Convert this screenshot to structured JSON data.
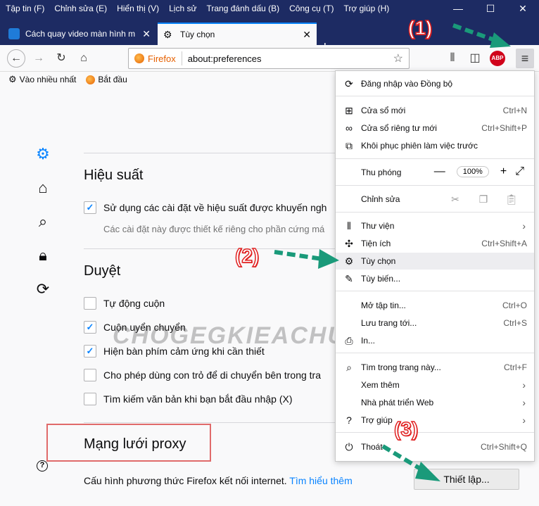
{
  "menubar": [
    "Tập tin (F)",
    "Chỉnh sửa (E)",
    "Hiển thị (V)",
    "Lịch sử",
    "Trang đánh dấu (B)",
    "Công cụ (T)",
    "Trợ giúp (H)"
  ],
  "tabs": [
    {
      "title": "Cách quay video màn hình m",
      "active": false
    },
    {
      "title": "Tùy chọn",
      "active": true
    }
  ],
  "urlbar": {
    "identity": "Firefox",
    "url": "about:preferences"
  },
  "bookmarks": [
    {
      "label": "Vào nhiều nhất",
      "icon": "gear-icon"
    },
    {
      "label": "Bắt đầu",
      "icon": "firefox-icon"
    }
  ],
  "prefs": {
    "performance": {
      "title": "Hiệu suất",
      "recommended_label": "Sử dụng các cài đặt về hiệu suất được khuyến ngh",
      "recommended_checked": true,
      "recommended_hint": "Các cài đặt này được thiết kế riêng cho phần cứng má"
    },
    "browsing": {
      "title": "Duyệt",
      "options": [
        {
          "label": "Tự động cuộn",
          "checked": false
        },
        {
          "label": "Cuộn uyển chuyển",
          "checked": true
        },
        {
          "label": "Hiện bàn phím cảm ứng khi cần thiết",
          "checked": true
        },
        {
          "label": "Cho phép dùng con trỏ để di chuyển bên trong tra",
          "checked": false
        },
        {
          "label": "Tìm kiếm văn bản khi bạn bắt đầu nhập (X)",
          "checked": false
        }
      ]
    },
    "proxy": {
      "title": "Mạng lưới proxy",
      "description": "Cấu hình phương thức Firefox kết nối internet.",
      "learn_more": "Tìm hiểu thêm",
      "settings_button": "Thiết lập..."
    }
  },
  "menu_panel": {
    "sync": "Đăng nhập vào Đồng bộ",
    "new_window": {
      "label": "Cửa sổ mới",
      "shortcut": "Ctrl+N"
    },
    "private_window": {
      "label": "Cửa sổ riêng tư mới",
      "shortcut": "Ctrl+Shift+P"
    },
    "restore_session": "Khôi phục phiên làm việc trước",
    "zoom": {
      "label": "Thu phóng",
      "value": "100%"
    },
    "edit": "Chỉnh sửa",
    "library": "Thư viện",
    "addons": {
      "label": "Tiện ích",
      "shortcut": "Ctrl+Shift+A"
    },
    "options": "Tùy chọn",
    "customize": "Tùy biến...",
    "open_file": {
      "label": "Mở tập tin...",
      "shortcut": "Ctrl+O"
    },
    "save_page": {
      "label": "Lưu trang tới...",
      "shortcut": "Ctrl+S"
    },
    "print": "In...",
    "find": {
      "label": "Tìm trong trang này...",
      "shortcut": "Ctrl+F"
    },
    "more": "Xem thêm",
    "web_developer": "Nhà phát triển Web",
    "help": "Trợ giúp",
    "quit": {
      "label": "Thoát",
      "shortcut": "Ctrl+Shift+Q"
    }
  },
  "annotations": [
    "(1)",
    "(2)",
    "(3)"
  ],
  "watermark": "CHOGEGKIEACHUC",
  "colors": {
    "titlebar": "#1d2b63",
    "accent": "#0a84ff",
    "annotation": "#e02020",
    "arrow": "#1a9a7a"
  }
}
